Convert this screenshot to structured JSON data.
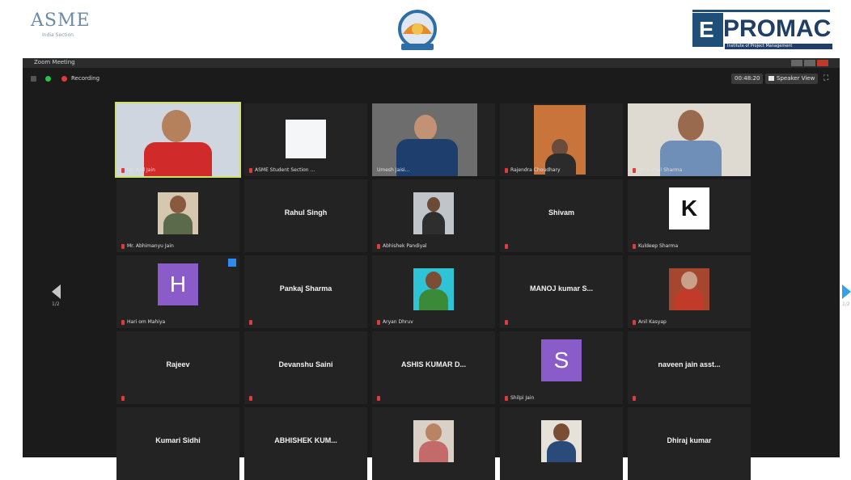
{
  "banner": {
    "asme_word": "ASME",
    "asme_sub": "India Section",
    "promac_letter": "E",
    "promac_word": "PROMAC",
    "promac_tag": "Institute of Project Management"
  },
  "window": {
    "title": "Zoom Meeting"
  },
  "toolbar": {
    "recording_label": "Recording",
    "time": "00:48:20",
    "view_label": "Speaker View"
  },
  "nav": {
    "left_page": "1/2",
    "right_page": "1/2"
  },
  "tiles": [
    {
      "id": "t1",
      "label": "Mr. Anil Jain",
      "name": ""
    },
    {
      "id": "t2",
      "label": "ASME Student Section ...",
      "name": ""
    },
    {
      "id": "t3",
      "label": "Umesh Jaisi...",
      "name": ""
    },
    {
      "id": "t4",
      "label": "Rajendra Choudhary",
      "name": ""
    },
    {
      "id": "t5",
      "label": "Dr. Kamal Sharma",
      "name": ""
    },
    {
      "id": "t6",
      "label": "Mr. Abhimanyu Jain",
      "name": ""
    },
    {
      "id": "t7",
      "label": "",
      "name": "Rahul Singh"
    },
    {
      "id": "t8",
      "label": "Abhishek Pandiyal",
      "name": ""
    },
    {
      "id": "t9",
      "label": "",
      "name": "Shivam"
    },
    {
      "id": "t10",
      "label": "Kuldeep Sharma",
      "name": "",
      "initial": "K"
    },
    {
      "id": "t11",
      "label": "Hari om Mahiya",
      "name": "",
      "initial": "H"
    },
    {
      "id": "t12",
      "label": "",
      "name": "Pankaj Sharma"
    },
    {
      "id": "t13",
      "label": "Aryan Dhruv",
      "name": ""
    },
    {
      "id": "t14",
      "label": "",
      "name": "MANOJ kumar S..."
    },
    {
      "id": "t15",
      "label": "Anil Kasyap",
      "name": ""
    },
    {
      "id": "t16",
      "label": "",
      "name": "Rajeev"
    },
    {
      "id": "t17",
      "label": "",
      "name": "Devanshu Saini"
    },
    {
      "id": "t18",
      "label": "",
      "name": "ASHIS KUMAR D..."
    },
    {
      "id": "t19",
      "label": "Shilpi Jain",
      "name": "",
      "initial": "S"
    },
    {
      "id": "t20",
      "label": "",
      "name": "naveen jain asst..."
    },
    {
      "id": "t21",
      "label": "",
      "name": "Kumari Sidhi"
    },
    {
      "id": "t22",
      "label": "",
      "name": "ABHISHEK KUM..."
    },
    {
      "id": "t23",
      "label": "",
      "name": ""
    },
    {
      "id": "t24",
      "label": "",
      "name": ""
    },
    {
      "id": "t25",
      "label": "",
      "name": "Dhiraj kumar"
    }
  ],
  "colors": {
    "accent_border": "#cde26a",
    "avatar_purple": "#8a5cc9",
    "mic_muted": "#e03b3b",
    "nav_blue": "#3aa0e6"
  }
}
